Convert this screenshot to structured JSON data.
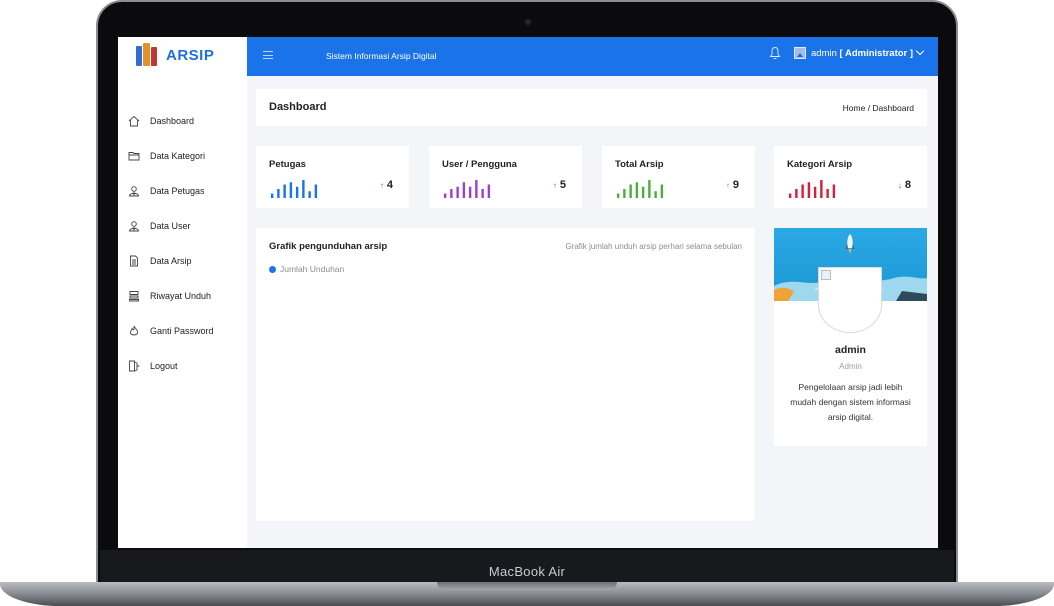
{
  "device": {
    "label": "MacBook Air"
  },
  "brand": {
    "name": "ARSIP"
  },
  "topbar": {
    "title": "Sistem Informasi Arsip Digital",
    "user_name": "admin",
    "user_role": "[ Administrator ]"
  },
  "sidebar": {
    "items": [
      {
        "label": "Dashboard",
        "icon": "home-icon"
      },
      {
        "label": "Data Kategori",
        "icon": "folder-icon"
      },
      {
        "label": "Data Petugas",
        "icon": "user-tie-icon"
      },
      {
        "label": "Data User",
        "icon": "user-tie-icon"
      },
      {
        "label": "Data Arsip",
        "icon": "document-icon"
      },
      {
        "label": "Riwayat Unduh",
        "icon": "archive-box-icon"
      },
      {
        "label": "Ganti Password",
        "icon": "flame-icon"
      },
      {
        "label": "Logout",
        "icon": "door-exit-icon"
      }
    ]
  },
  "page": {
    "title": "Dashboard",
    "breadcrumb": "Home / Dashboard"
  },
  "stats": [
    {
      "title": "Petugas",
      "value": "4",
      "color": "#1a73e8",
      "bars": [
        2,
        4,
        6,
        7,
        5,
        8,
        3,
        6
      ]
    },
    {
      "title": "User / Pengguna",
      "value": "5",
      "color": "#9b3fd1",
      "bars": [
        2,
        4,
        5,
        7,
        5,
        8,
        4,
        6
      ]
    },
    {
      "title": "Total Arsip",
      "value": "9",
      "color": "#4caf3a",
      "bars": [
        2,
        4,
        6,
        7,
        5,
        8,
        3,
        6
      ]
    },
    {
      "title": "Kategori Arsip",
      "value": "8",
      "color": "#d61f3a",
      "bars": [
        2,
        4,
        6,
        7,
        5,
        8,
        4,
        6
      ]
    }
  ],
  "chart": {
    "title": "Grafik pengunduhan arsip",
    "subtitle": "Grafik jumlah unduh arsip perhari selama sebulan",
    "legend": "Jumlah Unduhan",
    "legend_color": "#1a73e8"
  },
  "profile": {
    "name": "admin",
    "role": "Admin",
    "description": "Pengelolaan arsip jadi lebih mudah dengan sistem informasi arsip digital."
  }
}
